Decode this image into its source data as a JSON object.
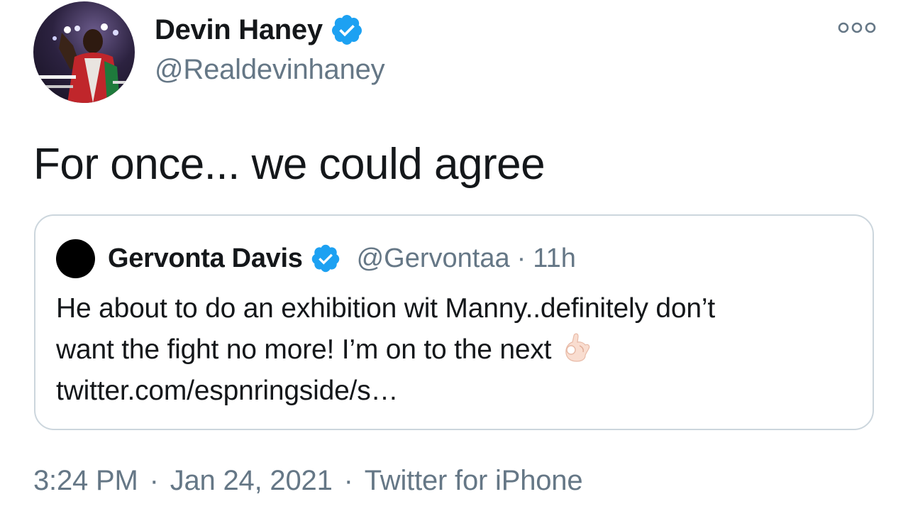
{
  "tweet": {
    "author": {
      "name": "Devin Haney",
      "handle": "@Realdevinhaney",
      "verified": true
    },
    "text": "For once... we could agree",
    "timestamp": {
      "time": "3:24 PM",
      "separator": "·",
      "date": "Jan 24, 2021",
      "source": "Twitter for iPhone"
    }
  },
  "quoted_tweet": {
    "author": {
      "name": "Gervonta Davis",
      "handle": "@Gervontaa",
      "verified": true
    },
    "separator": "·",
    "time_ago": "11h",
    "text_lines": [
      "He about to do an exhibition wit Manny..definitely don’t",
      "want the fight no more! I’m on to the next",
      "twitter.com/espnringside/s…"
    ],
    "emoji": "ok-hand-emoji"
  },
  "colors": {
    "text": "#14171a",
    "secondary": "#657786",
    "verified_blue": "#1da1f2",
    "border": "#ccd6dd"
  },
  "icons": {
    "more": "more-options-icon",
    "verified": "verified-badge-icon"
  }
}
